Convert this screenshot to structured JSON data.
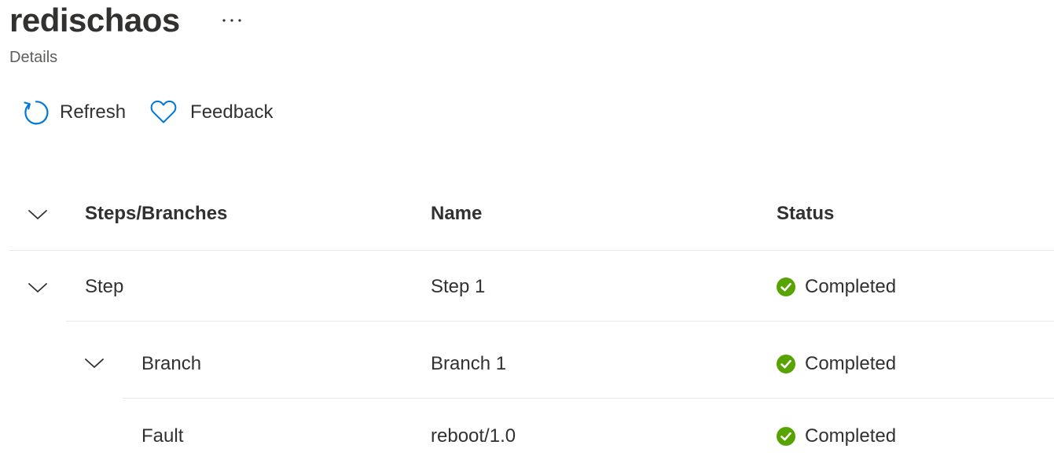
{
  "header": {
    "title": "redischaos",
    "more_icon": "ellipsis-icon",
    "subtitle": "Details"
  },
  "toolbar": {
    "refresh_label": "Refresh",
    "refresh_icon": "refresh-icon",
    "feedback_label": "Feedback",
    "feedback_icon": "heart-icon"
  },
  "grid": {
    "columns": [
      "Steps/Branches",
      "Name",
      "Status"
    ],
    "rows": [
      {
        "type": "Step",
        "name": "Step 1",
        "status": "Completed",
        "expanded": true
      },
      {
        "type": "Branch",
        "name": "Branch 1",
        "status": "Completed",
        "expanded": true
      },
      {
        "type": "Fault",
        "name": "reboot/1.0",
        "status": "Completed"
      }
    ]
  },
  "colors": {
    "accent": "#0078d4",
    "success": "#57a300",
    "text": "#323130",
    "subtle_text": "#605e5c",
    "divider": "#e8e8e8"
  }
}
